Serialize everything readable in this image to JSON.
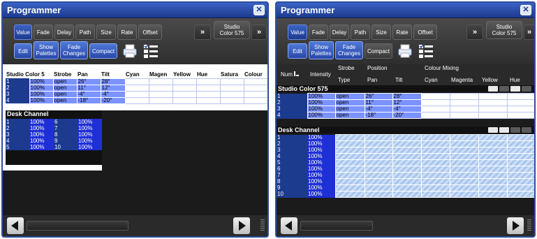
{
  "left": {
    "title": "Programmer",
    "toolbar": {
      "value": "Value",
      "fade": "Fade",
      "delay": "Delay",
      "path": "Path",
      "size": "Size",
      "rate": "Rate",
      "offset": "Offset",
      "more": "»",
      "fixture_line1": "Studio",
      "fixture_line2": "Color 575",
      "more2": "»",
      "edit": "Edit",
      "show_palettes_1": "Show",
      "show_palettes_2": "Palettes",
      "fade_changes_1": "Fade",
      "fade_changes_2": "Changes",
      "compact": "Compact"
    },
    "columns": [
      "Studio Color 5",
      "Strobe",
      "Pan",
      "Tilt",
      "Cyan",
      "Magen",
      "Yellow",
      "Hue",
      "Satura",
      "Colour"
    ],
    "rows": [
      {
        "num": "1",
        "int": "100%",
        "strobe": "open",
        "pan": "26°",
        "tilt": "28°"
      },
      {
        "num": "2",
        "int": "100%",
        "strobe": "open",
        "pan": "11°",
        "tilt": "12°"
      },
      {
        "num": "3",
        "int": "100%",
        "strobe": "open",
        "pan": "-4°",
        "tilt": "-4°"
      },
      {
        "num": "4",
        "int": "100%",
        "strobe": "open",
        "pan": "-18°",
        "tilt": "-20°"
      }
    ],
    "desk_title": "Desk Channel",
    "desk": [
      {
        "a": "1",
        "av": "100%",
        "b": "6",
        "bv": "100%"
      },
      {
        "a": "2",
        "av": "100%",
        "b": "7",
        "bv": "100%"
      },
      {
        "a": "3",
        "av": "100%",
        "b": "8",
        "bv": "100%"
      },
      {
        "a": "4",
        "av": "100%",
        "b": "9",
        "bv": "100%"
      },
      {
        "a": "5",
        "av": "100%",
        "b": "10",
        "bv": "100%"
      }
    ]
  },
  "right": {
    "title": "Programmer",
    "header": {
      "num": "Num",
      "intensity": "Intensity",
      "strobe": "Strobe",
      "position": "Position",
      "colour_mixing": "Colour Mixing",
      "type": "Type",
      "pan": "Pan",
      "tilt": "Tilt",
      "cyan": "Cyan",
      "magenta": "Magenta",
      "yellow": "Yellow",
      "hue": "Hue"
    },
    "fixture_title": "Studio Color 575",
    "rows": [
      {
        "num": "1",
        "int": "100%",
        "strobe": "open",
        "pan": "26°",
        "tilt": "28°"
      },
      {
        "num": "2",
        "int": "100%",
        "strobe": "open",
        "pan": "11°",
        "tilt": "12°"
      },
      {
        "num": "3",
        "int": "100%",
        "strobe": "open",
        "pan": "-4°",
        "tilt": "-4°"
      },
      {
        "num": "4",
        "int": "100%",
        "strobe": "open",
        "pan": "-18°",
        "tilt": "-20°"
      }
    ],
    "desk_title": "Desk Channel",
    "desk": [
      {
        "num": "1",
        "int": "100%"
      },
      {
        "num": "2",
        "int": "100%"
      },
      {
        "num": "3",
        "int": "100%"
      },
      {
        "num": "4",
        "int": "100%"
      },
      {
        "num": "5",
        "int": "100%"
      },
      {
        "num": "6",
        "int": "100%"
      },
      {
        "num": "7",
        "int": "100%"
      },
      {
        "num": "8",
        "int": "100%"
      },
      {
        "num": "9",
        "int": "100%"
      },
      {
        "num": "10",
        "int": "100%"
      }
    ]
  },
  "colors": {
    "title_blue": "#2c4fa0",
    "value_cell": "#7b93ff",
    "intensity_cell": "#1f2fd8",
    "hatch": "#a9c6ee"
  },
  "icons": [
    "close-icon",
    "printer-icon",
    "checklist-icon",
    "scroll-left-icon",
    "scroll-right-icon",
    "sort-icon"
  ]
}
